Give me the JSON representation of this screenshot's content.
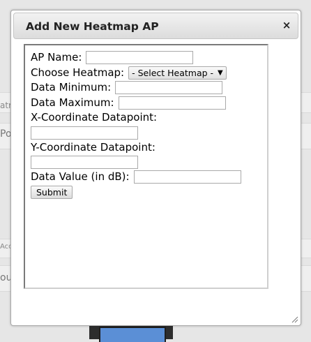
{
  "background": {
    "frag1": "atr",
    "frag2": "Po",
    "frag3": "Acc",
    "frag4": "ou"
  },
  "dialog": {
    "title": "Add New Heatmap AP",
    "close_glyph": "×",
    "fields": {
      "ap_name_label": "AP Name:",
      "ap_name_value": "",
      "heatmap_label": "Choose Heatmap:",
      "heatmap_selected": "- Select Heatmap -",
      "data_min_label": "Data Minimum:",
      "data_min_value": "",
      "data_max_label": "Data Maximum:",
      "data_max_value": "",
      "x_coord_label": "X-Coordinate Datapoint:",
      "x_coord_value": "",
      "y_coord_label": "Y-Coordinate Datapoint:",
      "y_coord_value": "",
      "data_value_label": "Data Value (in dB):",
      "data_value_value": ""
    },
    "submit_label": "Submit"
  }
}
